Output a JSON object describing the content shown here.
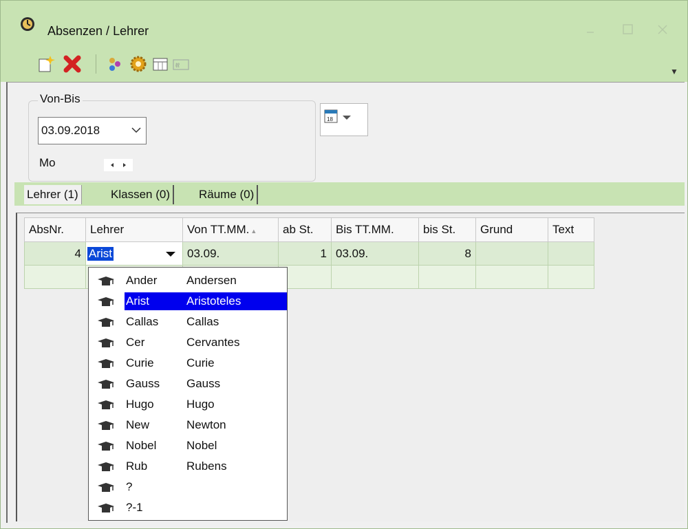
{
  "window": {
    "title": "Absenzen / Lehrer",
    "icons": [
      "clock-icon",
      "minimize-icon",
      "maximize-icon",
      "close-icon"
    ]
  },
  "toolbar": {
    "items": [
      "new-icon",
      "delete-icon",
      "people-icon",
      "settings-gear-icon",
      "calendar-list-icon",
      "report-icon"
    ]
  },
  "filter": {
    "group_label": "Von-Bis",
    "date_value": "03.09.2018",
    "weekday": "Mo"
  },
  "tabs": [
    {
      "label": "Lehrer (1)",
      "active": true
    },
    {
      "label": "Klassen (0)",
      "active": false
    },
    {
      "label": "Räume (0)",
      "active": false
    }
  ],
  "grid": {
    "columns": [
      "AbsNr.",
      "Lehrer",
      "Von TT.MM.",
      "ab St.",
      "Bis TT.MM.",
      "bis St.",
      "Grund",
      "Text"
    ],
    "sort_column": "Von TT.MM.",
    "rows": [
      {
        "absnr": "4",
        "lehrer": "Arist",
        "von": "03.09.",
        "ab": "1",
        "bis": "03.09.",
        "bisst": "8",
        "grund": "",
        "text": ""
      }
    ]
  },
  "dropdown": {
    "items": [
      {
        "short": "Ander",
        "long": "Andersen",
        "selected": false
      },
      {
        "short": "Arist",
        "long": "Aristoteles",
        "selected": true
      },
      {
        "short": "Callas",
        "long": "Callas",
        "selected": false
      },
      {
        "short": "Cer",
        "long": "Cervantes",
        "selected": false
      },
      {
        "short": "Curie",
        "long": "Curie",
        "selected": false
      },
      {
        "short": "Gauss",
        "long": "Gauss",
        "selected": false
      },
      {
        "short": "Hugo",
        "long": "Hugo",
        "selected": false
      },
      {
        "short": "New",
        "long": "Newton",
        "selected": false
      },
      {
        "short": "Nobel",
        "long": "Nobel",
        "selected": false
      },
      {
        "short": "Rub",
        "long": "Rubens",
        "selected": false
      },
      {
        "short": "?",
        "long": "",
        "selected": false
      },
      {
        "short": "?-1",
        "long": "",
        "selected": false
      }
    ],
    "item_icon": "teacher-hat-icon"
  },
  "colors": {
    "titlebar": "#c8e3b3",
    "row": "#dcebd3",
    "selection": "#0000ee"
  }
}
